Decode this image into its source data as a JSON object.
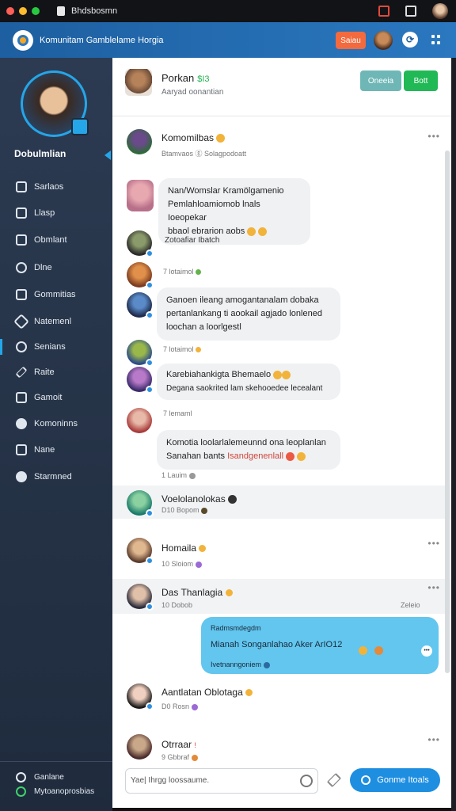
{
  "os": {
    "title": "Bhdsbosmn"
  },
  "app": {
    "title": "Komunitam Gamblelame Horgia",
    "header_button": "Saiau"
  },
  "sidebar": {
    "user_name": "Dobulmlian",
    "items": [
      {
        "label": "Sarlaos",
        "icon": "chat-icon"
      },
      {
        "label": "Llasp",
        "icon": "list-icon"
      },
      {
        "label": "Obmlant",
        "icon": "document-icon"
      },
      {
        "label": "Dlne",
        "icon": "info-icon"
      },
      {
        "label": "Gommitias",
        "icon": "message-icon"
      },
      {
        "label": "Natemenl",
        "icon": "tag-icon"
      },
      {
        "label": "Senians",
        "icon": "settings-icon"
      },
      {
        "label": "Raite",
        "icon": "edit-icon"
      },
      {
        "label": "Gamoit",
        "icon": "file-icon"
      },
      {
        "label": "Komoninns",
        "icon": "circle-icon"
      },
      {
        "label": "Nane",
        "icon": "grid-icon"
      },
      {
        "label": "Starmned",
        "icon": "star-icon"
      }
    ],
    "footer": [
      {
        "label": "Ganlane"
      },
      {
        "label": "Mytoanoprosbias"
      }
    ]
  },
  "channel": {
    "title": "Porkan",
    "title_accent": "$I3",
    "subtitle": "Aaryad oonantian",
    "btn_secondary": "Oneeia",
    "btn_primary": "Bott"
  },
  "messages": [
    {
      "name": "Komomilbas",
      "meta": "Btamvaos  ⓖ Solagpodoatt"
    },
    {
      "bubble": [
        "Nan/Womslar Kramölgamenio",
        "Pemlahloamiomob lnals Ioeopekar",
        "bbaol ebrarion aobs"
      ]
    },
    {
      "line": "Zotoafiar Ibatch"
    },
    {
      "line": "7 lotaimol"
    },
    {
      "bubble": [
        "Ganoen ileang amogantanalam dobaka",
        "pertanlankang ti aookail agjado lonlened",
        "loochan a loorlgestl"
      ]
    },
    {
      "line": "7 lotaimol"
    },
    {
      "name": "Karebiahankigta Bhemaelo",
      "text": "Degana saokrited lam skehooedee lecealant"
    },
    {
      "line": "7 lemaml"
    },
    {
      "bubble": [
        "Komotia loolarlalemeunnd ona leoplanlan",
        "Sanahan bants"
      ],
      "bubble_red": "Isandgenenlall"
    },
    {
      "meta_only": "1 Lauim"
    },
    {
      "name": "Voelolanolokas",
      "meta": "D10 Bopom"
    },
    {
      "name": "Homaila",
      "meta": "10 Sloiom"
    },
    {
      "name": "Das Thanlagia",
      "meta": "10 Dobob",
      "meta_right": "Zeleio"
    },
    {
      "blue_bubble": {
        "top": "Radmsmdegdm",
        "main": "Mianah Songanlahao Aker ArIO12",
        "bottom": "Ivetnanngoniem"
      }
    },
    {
      "name": "Aantlatan Oblotaga",
      "meta": "D0 Rosn"
    },
    {
      "name": "Otrraar",
      "meta": "9 Gbbraf"
    }
  ],
  "composer": {
    "placeholder": "Yae| Ihrgg loossaume.",
    "send_label": "Gonme Itoals"
  }
}
